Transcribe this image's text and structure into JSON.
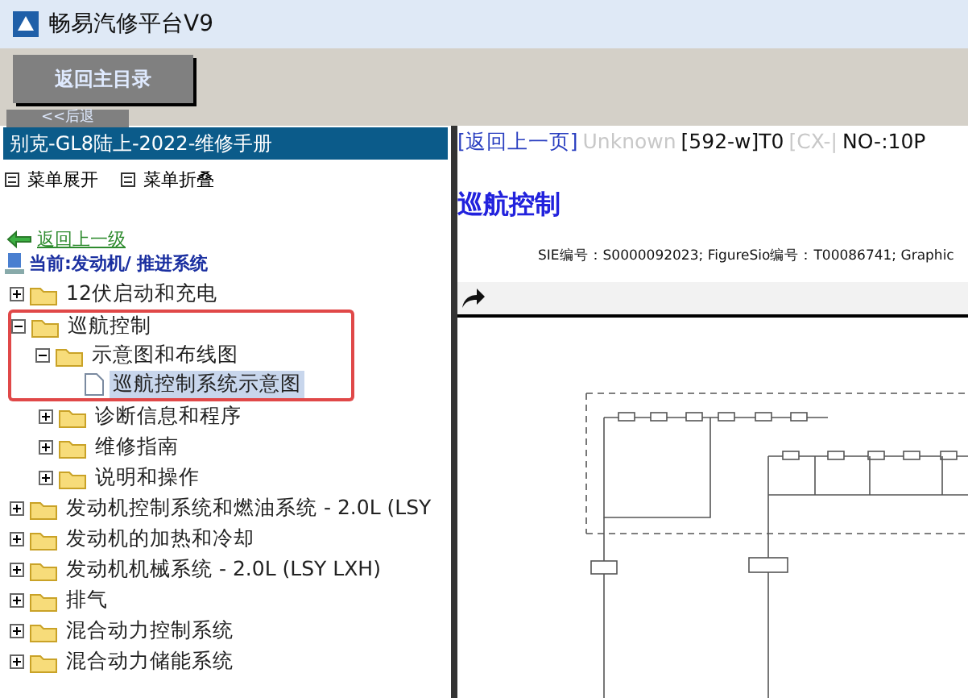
{
  "window": {
    "title": "畅易汽修平台V9"
  },
  "toolbar": {
    "buttons": [
      {
        "label": "返回主目录"
      },
      {
        "label": "<<后退"
      }
    ]
  },
  "sidebar": {
    "title": "别克-GL8陆上-2022-维修手册",
    "actions": [
      {
        "label": "菜单展开"
      },
      {
        "label": "菜单折叠"
      }
    ],
    "back_link": "返回上一级",
    "current_path": "当前:发动机/ 推进系统",
    "tree": [
      {
        "kind": "folder",
        "label": "12伏启动和充电",
        "expanded": false,
        "selected": false,
        "outlined": false
      },
      {
        "kind": "folder",
        "label": "巡航控制",
        "expanded": true,
        "selected": false,
        "outlined": true,
        "children": [
          {
            "kind": "folder",
            "label": "示意图和布线图",
            "expanded": true,
            "selected": false,
            "outlined": true,
            "children": [
              {
                "kind": "document",
                "label": "巡航控制系统示意图",
                "selected": true,
                "outlined": true
              }
            ]
          },
          {
            "kind": "folder",
            "label": "诊断信息和程序",
            "expanded": false,
            "selected": false,
            "outlined": false
          },
          {
            "kind": "folder",
            "label": "维修指南",
            "expanded": false,
            "selected": false,
            "outlined": false
          },
          {
            "kind": "folder",
            "label": "说明和操作",
            "expanded": false,
            "selected": false,
            "outlined": false
          }
        ]
      },
      {
        "kind": "folder",
        "label": "发动机控制系统和燃油系统 - 2.0L (LSY",
        "expanded": false,
        "selected": false,
        "outlined": false
      },
      {
        "kind": "folder",
        "label": "发动机的加热和冷却",
        "expanded": false,
        "selected": false,
        "outlined": false
      },
      {
        "kind": "folder",
        "label": "发动机机械系统 - 2.0L (LSY LXH)",
        "expanded": false,
        "selected": false,
        "outlined": false
      },
      {
        "kind": "folder",
        "label": "排气",
        "expanded": false,
        "selected": false,
        "outlined": false
      },
      {
        "kind": "folder",
        "label": "混合动力控制系统",
        "expanded": false,
        "selected": false,
        "outlined": false
      },
      {
        "kind": "folder",
        "label": "混合动力储能系统",
        "expanded": false,
        "selected": false,
        "outlined": false
      }
    ]
  },
  "content": {
    "nav": [
      {
        "text": "[返回上一页]",
        "kind": "link"
      },
      {
        "text": "Unknown",
        "kind": "muted"
      },
      {
        "text": "[592-w]T0",
        "kind": "plain"
      },
      {
        "text": "[CX-|",
        "kind": "muted"
      },
      {
        "text": "NO-:10P",
        "kind": "plain"
      }
    ],
    "title": "巡航控制",
    "info": "SIE编号：S0000092023;  FigureSio编号：T00086741;  Graphic"
  }
}
